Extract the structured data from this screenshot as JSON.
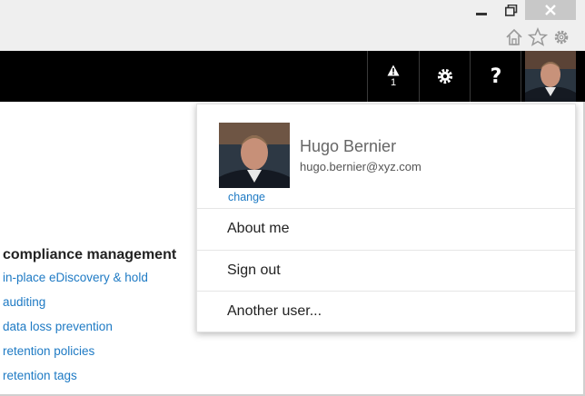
{
  "browser": {
    "minimize_icon": "minimize-icon",
    "restore_icon": "restore-icon",
    "close_icon": "close-icon",
    "home_icon": "home-icon",
    "favorites_icon": "star-icon",
    "tools_icon": "gear-icon"
  },
  "topbar": {
    "alert_count": "1",
    "alert_icon": "warning-icon",
    "settings_icon": "gear-icon",
    "help_label": "?",
    "background": "#000000"
  },
  "left_nav": {
    "heading": "compliance management",
    "links": [
      "in-place eDiscovery & hold",
      "auditing",
      "data loss prevention",
      "retention policies",
      "retention tags"
    ],
    "link_color": "#1e7ac4"
  },
  "account_panel": {
    "change_label": "change",
    "name": "Hugo Bernier",
    "email": "hugo.bernier@xyz.com",
    "menu": [
      "About me",
      "Sign out",
      "Another user..."
    ]
  }
}
